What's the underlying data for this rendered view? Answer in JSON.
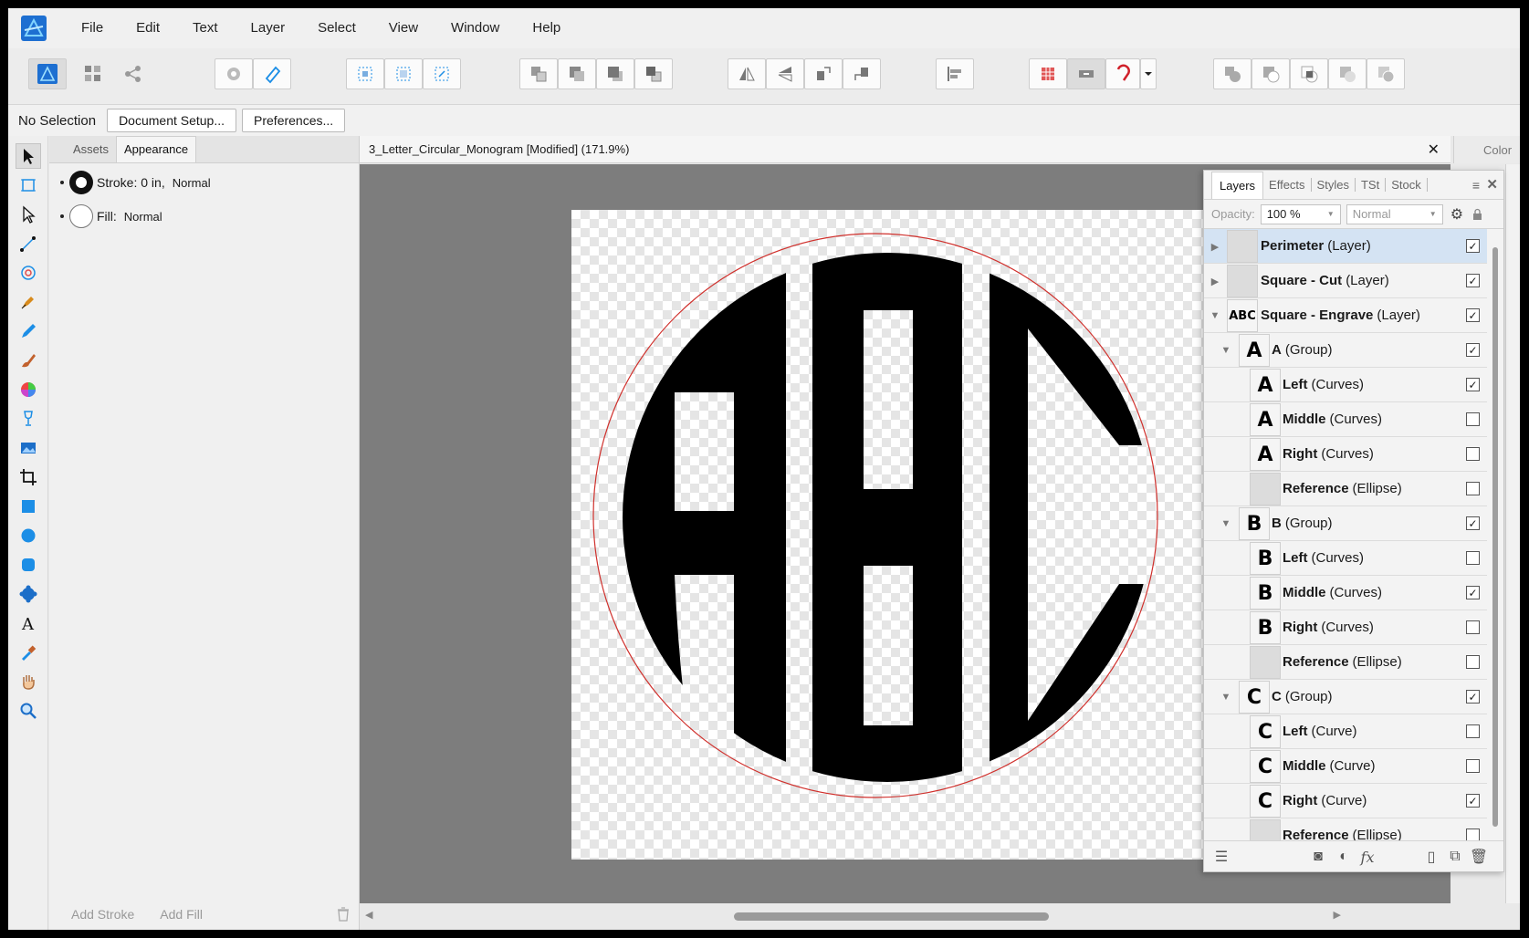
{
  "menu": [
    "File",
    "Edit",
    "Text",
    "Layer",
    "Select",
    "View",
    "Window",
    "Help"
  ],
  "context": {
    "selection": "No Selection",
    "document_setup": "Document Setup...",
    "preferences": "Preferences..."
  },
  "appearance": {
    "tabs": [
      "Assets",
      "Appearance"
    ],
    "stroke_label": "Stroke: 0 in,",
    "stroke_mode": "Normal",
    "fill_label": "Fill:",
    "fill_mode": "Normal",
    "add_stroke": "Add Stroke",
    "add_fill": "Add Fill"
  },
  "document": {
    "title": "3_Letter_Circular_Monogram [Modified] (171.9%)",
    "close_glyph": "✕"
  },
  "color_tab": "Color",
  "artwork": {
    "letters": [
      "A",
      "B",
      "C"
    ],
    "perimeter_color": "#d0312d",
    "fill_color": "#000000"
  },
  "layers_panel": {
    "tabs": [
      "Layers",
      "Effects",
      "Styles",
      "TSt",
      "Stock"
    ],
    "opacity_label": "Opacity:",
    "opacity_value": "100 %",
    "blend_mode": "Normal",
    "rows": [
      {
        "name": "Perimeter",
        "kind": "(Layer)",
        "level": 0,
        "expand": "collapsed",
        "thumb": "",
        "checked": true,
        "selected": true
      },
      {
        "name": "Square - Cut",
        "kind": "(Layer)",
        "level": 0,
        "expand": "collapsed",
        "thumb": "",
        "checked": true,
        "selected": false
      },
      {
        "name": "Square - Engrave",
        "kind": "(Layer)",
        "level": 0,
        "expand": "expanded",
        "thumb": "ABC",
        "checked": true,
        "selected": false
      },
      {
        "name": "A",
        "kind": "(Group)",
        "level": 1,
        "expand": "expanded",
        "thumb": "A",
        "checked": true,
        "selected": false
      },
      {
        "name": "Left",
        "kind": "(Curves)",
        "level": 2,
        "expand": "none",
        "thumb": "A",
        "checked": true,
        "selected": false
      },
      {
        "name": "Middle",
        "kind": "(Curves)",
        "level": 2,
        "expand": "none",
        "thumb": "A",
        "checked": false,
        "selected": false
      },
      {
        "name": "Right",
        "kind": "(Curves)",
        "level": 2,
        "expand": "none",
        "thumb": "A",
        "checked": false,
        "selected": false
      },
      {
        "name": "Reference",
        "kind": "(Ellipse)",
        "level": 2,
        "expand": "none",
        "thumb": "",
        "checked": false,
        "selected": false
      },
      {
        "name": "B",
        "kind": "(Group)",
        "level": 1,
        "expand": "expanded",
        "thumb": "B",
        "checked": true,
        "selected": false
      },
      {
        "name": "Left",
        "kind": "(Curves)",
        "level": 2,
        "expand": "none",
        "thumb": "B",
        "checked": false,
        "selected": false
      },
      {
        "name": "Middle",
        "kind": "(Curves)",
        "level": 2,
        "expand": "none",
        "thumb": "B",
        "checked": true,
        "selected": false
      },
      {
        "name": "Right",
        "kind": "(Curves)",
        "level": 2,
        "expand": "none",
        "thumb": "B",
        "checked": false,
        "selected": false
      },
      {
        "name": "Reference",
        "kind": "(Ellipse)",
        "level": 2,
        "expand": "none",
        "thumb": "",
        "checked": false,
        "selected": false
      },
      {
        "name": "C",
        "kind": "(Group)",
        "level": 1,
        "expand": "expanded",
        "thumb": "C",
        "checked": true,
        "selected": false
      },
      {
        "name": "Left",
        "kind": "(Curve)",
        "level": 2,
        "expand": "none",
        "thumb": "C",
        "checked": false,
        "selected": false
      },
      {
        "name": "Middle",
        "kind": "(Curve)",
        "level": 2,
        "expand": "none",
        "thumb": "C",
        "checked": false,
        "selected": false
      },
      {
        "name": "Right",
        "kind": "(Curve)",
        "level": 2,
        "expand": "none",
        "thumb": "C",
        "checked": true,
        "selected": false
      },
      {
        "name": "Reference",
        "kind": "(Ellipse)",
        "level": 2,
        "expand": "none",
        "thumb": "",
        "checked": false,
        "selected": false
      }
    ]
  },
  "colors": {
    "accent": "#1c8ee6",
    "selection_row": "#d4e3f3"
  }
}
